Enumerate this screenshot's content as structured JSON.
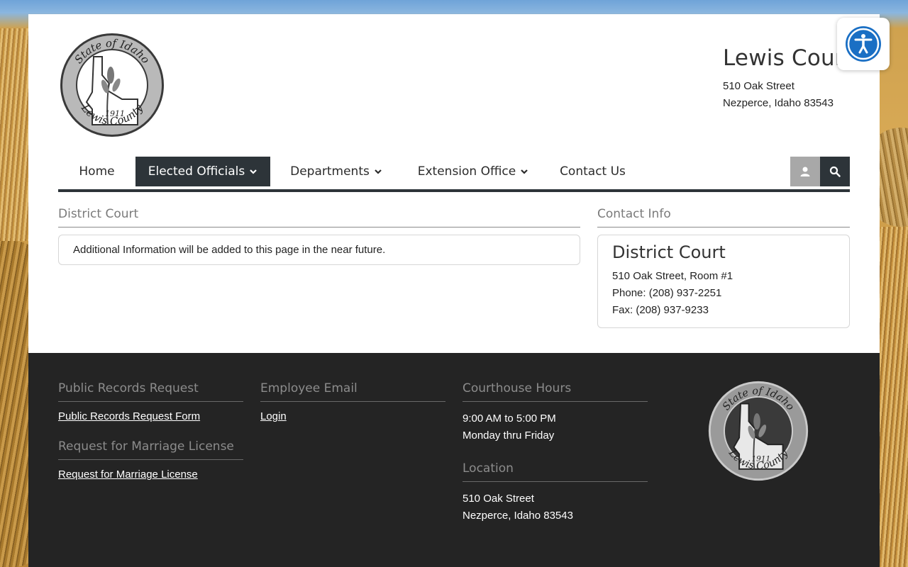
{
  "header": {
    "county_name": "Lewis County",
    "address_line1": "510 Oak Street",
    "address_line2": "Nezperce, Idaho 83543",
    "logo": {
      "top_text": "State of Idaho",
      "bottom_text": "Lewis County",
      "year": "1911"
    }
  },
  "nav": {
    "items": [
      {
        "label": "Home"
      },
      {
        "label": "Elected Officials"
      },
      {
        "label": "Departments"
      },
      {
        "label": "Extension Office"
      },
      {
        "label": "Contact Us"
      }
    ],
    "active_index": 1,
    "user_icon": "user-icon",
    "search_icon": "search-icon"
  },
  "main": {
    "title": "District Court",
    "message": "Additional Information will be added to this page in the near future."
  },
  "contact": {
    "section_title": "Contact Info",
    "name": "District Court",
    "address": "510 Oak Street, Room #1",
    "phone": "Phone: (208) 937-2251",
    "fax": "Fax: (208) 937-9233"
  },
  "footer": {
    "public_records": {
      "title": "Public Records Request",
      "link": "Public Records Request Form"
    },
    "marriage": {
      "title": "Request for Marriage License",
      "link": "Request for Marriage License"
    },
    "employee_email": {
      "title": "Employee Email",
      "link": "Login"
    },
    "hours": {
      "title": "Courthouse Hours",
      "line1": "9:00 AM to 5:00 PM",
      "line2": "Monday thru Friday"
    },
    "location": {
      "title": "Location",
      "line1": "510 Oak Street",
      "line2": "Nezperce, Idaho 83543"
    }
  },
  "accessibility": {
    "icon": "accessibility-icon"
  },
  "colors": {
    "nav_dark": "#2d3439",
    "footer_bg": "#242424",
    "accessibility_blue": "#1a6fc4"
  }
}
